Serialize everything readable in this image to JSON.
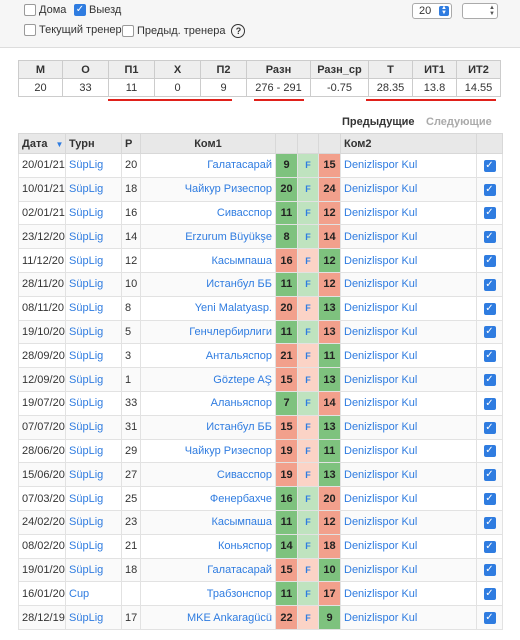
{
  "filters": {
    "home_label": "Дома",
    "home_checked": false,
    "away_label": "Выезд",
    "away_checked": true,
    "current_coach_label": "Текущий тренер",
    "current_coach_checked": false,
    "prev_coach_label": "Предыд. тренера",
    "prev_coach_checked": false,
    "help_glyph": "?",
    "count_value": "20",
    "number_value": ""
  },
  "stats": {
    "headers": [
      "М",
      "О",
      "П1",
      "Х",
      "П2",
      "Разн",
      "Разн_ср",
      "Т",
      "ИТ1",
      "ИТ2"
    ],
    "values": [
      "20",
      "33",
      "11",
      "0",
      "9",
      "276 - 291",
      "-0.75",
      "28.35",
      "13.8",
      "14.55"
    ]
  },
  "nav": {
    "previous": "Предыдущие",
    "next": "Следующие"
  },
  "table": {
    "headers": {
      "date": "Дата",
      "turn": "Турн",
      "round": "Р",
      "team1": "Ком1",
      "team2": "Ком2"
    },
    "draw_marker": "F",
    "rows": [
      {
        "date": "20/01/21",
        "turn": "SüpLig",
        "r": "20",
        "k1": "Галатасарай",
        "s1": "9",
        "s2": "15",
        "k2": "Denizlispor Kul",
        "win": "k2"
      },
      {
        "date": "10/01/21",
        "turn": "SüpLig",
        "r": "18",
        "k1": "Чайкур Ризеспор",
        "s1": "20",
        "s2": "24",
        "k2": "Denizlispor Kul",
        "win": "k2"
      },
      {
        "date": "02/01/21",
        "turn": "SüpLig",
        "r": "16",
        "k1": "Сивасспор",
        "s1": "11",
        "s2": "12",
        "k2": "Denizlispor Kul",
        "win": "k2"
      },
      {
        "date": "23/12/20",
        "turn": "SüpLig",
        "r": "14",
        "k1": "Erzurum Büyükşe",
        "s1": "8",
        "s2": "14",
        "k2": "Denizlispor Kul",
        "win": "k2"
      },
      {
        "date": "11/12/20",
        "turn": "SüpLig",
        "r": "12",
        "k1": "Касымпаша",
        "s1": "16",
        "s2": "12",
        "k2": "Denizlispor Kul",
        "win": "k1"
      },
      {
        "date": "28/11/20",
        "turn": "SüpLig",
        "r": "10",
        "k1": "Истанбул ББ",
        "s1": "11",
        "s2": "12",
        "k2": "Denizlispor Kul",
        "win": "k2"
      },
      {
        "date": "08/11/20",
        "turn": "SüpLig",
        "r": "8",
        "k1": "Yeni Malatyasp.",
        "s1": "20",
        "s2": "13",
        "k2": "Denizlispor Kul",
        "win": "k1"
      },
      {
        "date": "19/10/20",
        "turn": "SüpLig",
        "r": "5",
        "k1": "Генчлербирлиги",
        "s1": "11",
        "s2": "13",
        "k2": "Denizlispor Kul",
        "win": "k2"
      },
      {
        "date": "28/09/20",
        "turn": "SüpLig",
        "r": "3",
        "k1": "Антальяспор",
        "s1": "21",
        "s2": "11",
        "k2": "Denizlispor Kul",
        "win": "k1"
      },
      {
        "date": "12/09/20",
        "turn": "SüpLig",
        "r": "1",
        "k1": "Göztepe AŞ",
        "s1": "15",
        "s2": "13",
        "k2": "Denizlispor Kul",
        "win": "k1"
      },
      {
        "date": "19/07/20",
        "turn": "SüpLig",
        "r": "33",
        "k1": "Аланьяспор",
        "s1": "7",
        "s2": "14",
        "k2": "Denizlispor Kul",
        "win": "k2"
      },
      {
        "date": "07/07/20",
        "turn": "SüpLig",
        "r": "31",
        "k1": "Истанбул ББ",
        "s1": "15",
        "s2": "13",
        "k2": "Denizlispor Kul",
        "win": "k1"
      },
      {
        "date": "28/06/20",
        "turn": "SüpLig",
        "r": "29",
        "k1": "Чайкур Ризеспор",
        "s1": "19",
        "s2": "11",
        "k2": "Denizlispor Kul",
        "win": "k1"
      },
      {
        "date": "15/06/20",
        "turn": "SüpLig",
        "r": "27",
        "k1": "Сивасспор",
        "s1": "19",
        "s2": "13",
        "k2": "Denizlispor Kul",
        "win": "k1"
      },
      {
        "date": "07/03/20",
        "turn": "SüpLig",
        "r": "25",
        "k1": "Фенербахче",
        "s1": "16",
        "s2": "20",
        "k2": "Denizlispor Kul",
        "win": "k2"
      },
      {
        "date": "24/02/20",
        "turn": "SüpLig",
        "r": "23",
        "k1": "Касымпаша",
        "s1": "11",
        "s2": "12",
        "k2": "Denizlispor Kul",
        "win": "k2"
      },
      {
        "date": "08/02/20",
        "turn": "SüpLig",
        "r": "21",
        "k1": "Коньяспор",
        "s1": "14",
        "s2": "18",
        "k2": "Denizlispor Kul",
        "win": "k2"
      },
      {
        "date": "19/01/20",
        "turn": "SüpLig",
        "r": "18",
        "k1": "Галатасарай",
        "s1": "15",
        "s2": "10",
        "k2": "Denizlispor Kul",
        "win": "k1"
      },
      {
        "date": "16/01/20",
        "turn": "Cup",
        "r": "",
        "k1": "Трабзонспор",
        "s1": "11",
        "s2": "17",
        "k2": "Denizlispor Kul",
        "win": "k2"
      },
      {
        "date": "28/12/19",
        "turn": "SüpLig",
        "r": "17",
        "k1": "MKE Ankaragücü",
        "s1": "22",
        "s2": "9",
        "k2": "Denizlispor Kul",
        "win": "k1"
      }
    ]
  }
}
